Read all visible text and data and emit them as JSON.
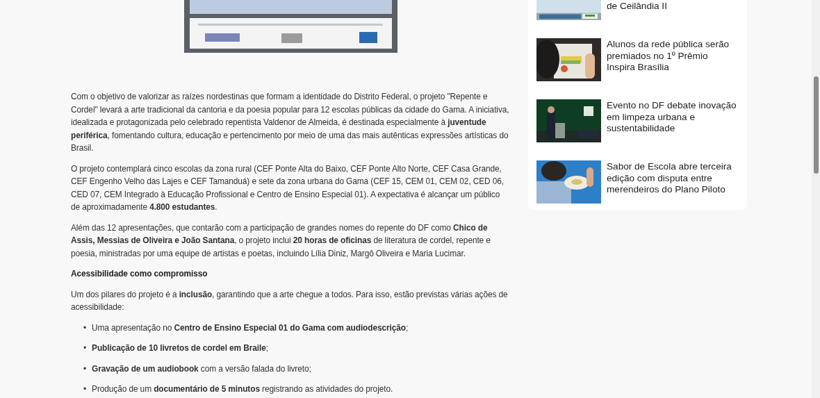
{
  "article": {
    "blocks": [
      {
        "kind": "paragraph",
        "text": "Com o objetivo de valorizar as raízes nordestinas que formam a identidade do Distrito Federal, o projeto \"Repente e Cordel\" levará a arte tradicional da cantoria e da poesia popular para 12 escolas públicas da cidade do Gama. A iniciativa, idealizada e protagonizada pelo celebrado repentista Valdenor de Almeida, é destinada especialmente à **juventude periférica**, fomentando cultura, educação e pertencimento por meio de uma das mais autênticas expressões artísticas do Brasil."
      },
      {
        "kind": "paragraph",
        "text": "O projeto contemplará cinco escolas da zona rural (CEF Ponte Alta do Baixo, CEF Ponte Alto Norte, CEF Casa Grande, CEF Engenho Velho das Lajes e CEF Tamanduá) e sete da zona urbana do Gama (CEF 15, CEM 01, CEM 02, CED 06, CED 07, CEM Integrado à Educação Profissional e Centro de Ensino Especial 01). A expectativa é alcançar um público de aproximadamente **4.800 estudantes**."
      },
      {
        "kind": "paragraph",
        "text": "Além das 12 apresentações, que contarão com a participação de grandes nomes do repente do DF como **Chico de Assis, Messias de Oliveira e João Santana**, o projeto inclui **20 horas de oficinas** de literatura de cordel, repente e poesia, ministradas por uma equipe de artistas e poetas, incluindo Lília Diniz, Margô Oliveira e Maria Lucimar."
      },
      {
        "kind": "heading",
        "text": "Acessibilidade como compromisso"
      },
      {
        "kind": "paragraph",
        "text": "Um dos pilares do projeto é a **inclusão**, garantindo que a arte chegue a todos. Para isso, estão previstas várias ações de acessibilidade:"
      },
      {
        "kind": "list",
        "items": [
          {
            "marker": "•",
            "text": "Uma apresentação no **Centro de Ensino Especial 01 do Gama com audiodescrição**;"
          },
          {
            "marker": "•",
            "text": "**Publicação de 10 livretos de cordel em Braile**;"
          },
          {
            "marker": "•",
            "text": "**Gravação de um audiobook** com a versão falada do livreto;"
          },
          {
            "marker": "•",
            "text": "Produção de um **documentário de 5 minutos** registrando as atividades do projeto."
          }
        ]
      }
    ]
  },
  "sidebar": {
    "items": [
      {
        "title": "de Ceilândia II"
      },
      {
        "title": "Alunos da rede pública serão premiados no 1º Prêmio Inspira Brasília"
      },
      {
        "title": "Evento no DF debate inovação em limpeza urbana e sustentabilidade"
      },
      {
        "title": "Sabor de Escola abre terceira edição com disputa entre merendeiros do Plano Piloto"
      }
    ]
  }
}
